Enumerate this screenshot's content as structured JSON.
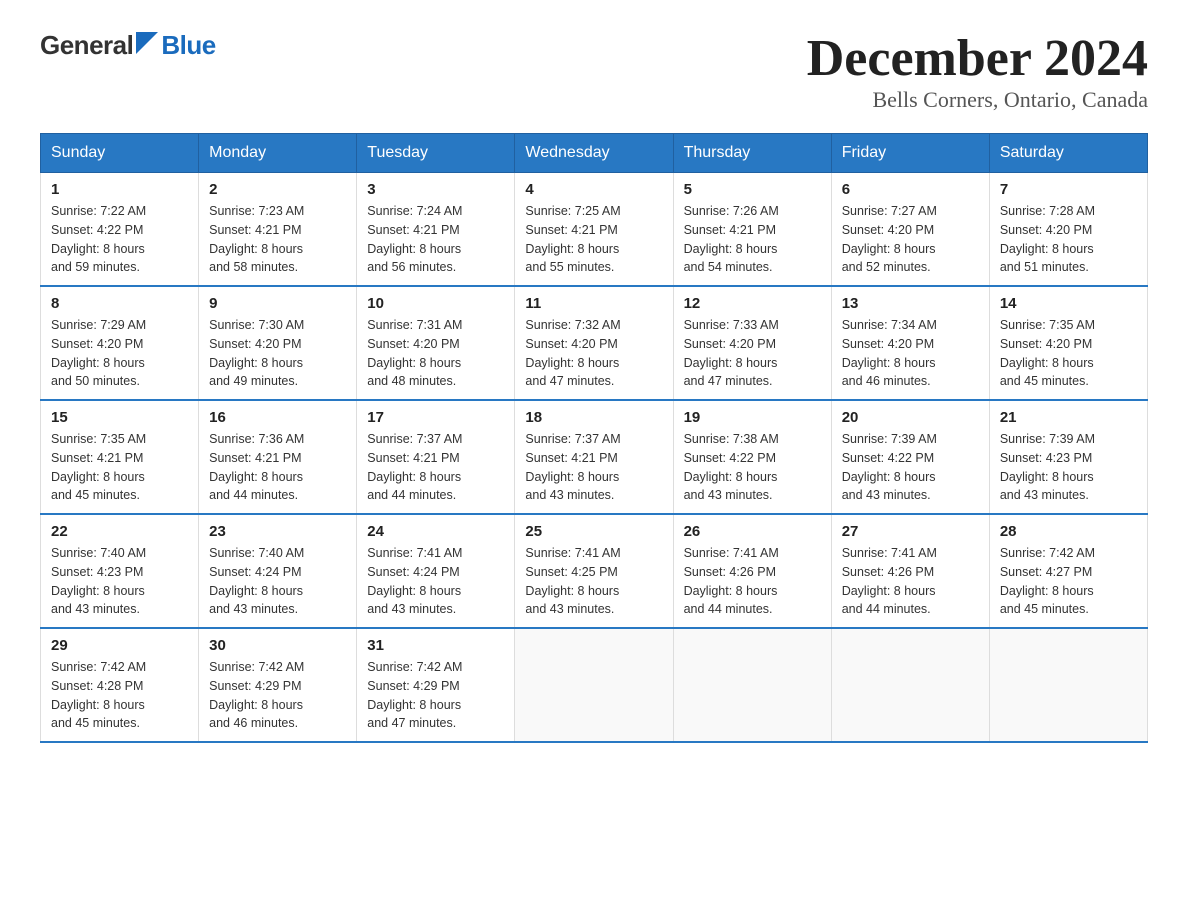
{
  "logo": {
    "part1": "General",
    "part2": "Blue",
    "subtitle": "Blue"
  },
  "header": {
    "title": "December 2024",
    "location": "Bells Corners, Ontario, Canada"
  },
  "days_of_week": [
    "Sunday",
    "Monday",
    "Tuesday",
    "Wednesday",
    "Thursday",
    "Friday",
    "Saturday"
  ],
  "weeks": [
    [
      {
        "day": "1",
        "sunrise": "7:22 AM",
        "sunset": "4:22 PM",
        "daylight": "8 hours and 59 minutes."
      },
      {
        "day": "2",
        "sunrise": "7:23 AM",
        "sunset": "4:21 PM",
        "daylight": "8 hours and 58 minutes."
      },
      {
        "day": "3",
        "sunrise": "7:24 AM",
        "sunset": "4:21 PM",
        "daylight": "8 hours and 56 minutes."
      },
      {
        "day": "4",
        "sunrise": "7:25 AM",
        "sunset": "4:21 PM",
        "daylight": "8 hours and 55 minutes."
      },
      {
        "day": "5",
        "sunrise": "7:26 AM",
        "sunset": "4:21 PM",
        "daylight": "8 hours and 54 minutes."
      },
      {
        "day": "6",
        "sunrise": "7:27 AM",
        "sunset": "4:20 PM",
        "daylight": "8 hours and 52 minutes."
      },
      {
        "day": "7",
        "sunrise": "7:28 AM",
        "sunset": "4:20 PM",
        "daylight": "8 hours and 51 minutes."
      }
    ],
    [
      {
        "day": "8",
        "sunrise": "7:29 AM",
        "sunset": "4:20 PM",
        "daylight": "8 hours and 50 minutes."
      },
      {
        "day": "9",
        "sunrise": "7:30 AM",
        "sunset": "4:20 PM",
        "daylight": "8 hours and 49 minutes."
      },
      {
        "day": "10",
        "sunrise": "7:31 AM",
        "sunset": "4:20 PM",
        "daylight": "8 hours and 48 minutes."
      },
      {
        "day": "11",
        "sunrise": "7:32 AM",
        "sunset": "4:20 PM",
        "daylight": "8 hours and 47 minutes."
      },
      {
        "day": "12",
        "sunrise": "7:33 AM",
        "sunset": "4:20 PM",
        "daylight": "8 hours and 47 minutes."
      },
      {
        "day": "13",
        "sunrise": "7:34 AM",
        "sunset": "4:20 PM",
        "daylight": "8 hours and 46 minutes."
      },
      {
        "day": "14",
        "sunrise": "7:35 AM",
        "sunset": "4:20 PM",
        "daylight": "8 hours and 45 minutes."
      }
    ],
    [
      {
        "day": "15",
        "sunrise": "7:35 AM",
        "sunset": "4:21 PM",
        "daylight": "8 hours and 45 minutes."
      },
      {
        "day": "16",
        "sunrise": "7:36 AM",
        "sunset": "4:21 PM",
        "daylight": "8 hours and 44 minutes."
      },
      {
        "day": "17",
        "sunrise": "7:37 AM",
        "sunset": "4:21 PM",
        "daylight": "8 hours and 44 minutes."
      },
      {
        "day": "18",
        "sunrise": "7:37 AM",
        "sunset": "4:21 PM",
        "daylight": "8 hours and 43 minutes."
      },
      {
        "day": "19",
        "sunrise": "7:38 AM",
        "sunset": "4:22 PM",
        "daylight": "8 hours and 43 minutes."
      },
      {
        "day": "20",
        "sunrise": "7:39 AM",
        "sunset": "4:22 PM",
        "daylight": "8 hours and 43 minutes."
      },
      {
        "day": "21",
        "sunrise": "7:39 AM",
        "sunset": "4:23 PM",
        "daylight": "8 hours and 43 minutes."
      }
    ],
    [
      {
        "day": "22",
        "sunrise": "7:40 AM",
        "sunset": "4:23 PM",
        "daylight": "8 hours and 43 minutes."
      },
      {
        "day": "23",
        "sunrise": "7:40 AM",
        "sunset": "4:24 PM",
        "daylight": "8 hours and 43 minutes."
      },
      {
        "day": "24",
        "sunrise": "7:41 AM",
        "sunset": "4:24 PM",
        "daylight": "8 hours and 43 minutes."
      },
      {
        "day": "25",
        "sunrise": "7:41 AM",
        "sunset": "4:25 PM",
        "daylight": "8 hours and 43 minutes."
      },
      {
        "day": "26",
        "sunrise": "7:41 AM",
        "sunset": "4:26 PM",
        "daylight": "8 hours and 44 minutes."
      },
      {
        "day": "27",
        "sunrise": "7:41 AM",
        "sunset": "4:26 PM",
        "daylight": "8 hours and 44 minutes."
      },
      {
        "day": "28",
        "sunrise": "7:42 AM",
        "sunset": "4:27 PM",
        "daylight": "8 hours and 45 minutes."
      }
    ],
    [
      {
        "day": "29",
        "sunrise": "7:42 AM",
        "sunset": "4:28 PM",
        "daylight": "8 hours and 45 minutes."
      },
      {
        "day": "30",
        "sunrise": "7:42 AM",
        "sunset": "4:29 PM",
        "daylight": "8 hours and 46 minutes."
      },
      {
        "day": "31",
        "sunrise": "7:42 AM",
        "sunset": "4:29 PM",
        "daylight": "8 hours and 47 minutes."
      },
      null,
      null,
      null,
      null
    ]
  ],
  "labels": {
    "sunrise": "Sunrise:",
    "sunset": "Sunset:",
    "daylight": "Daylight:"
  }
}
